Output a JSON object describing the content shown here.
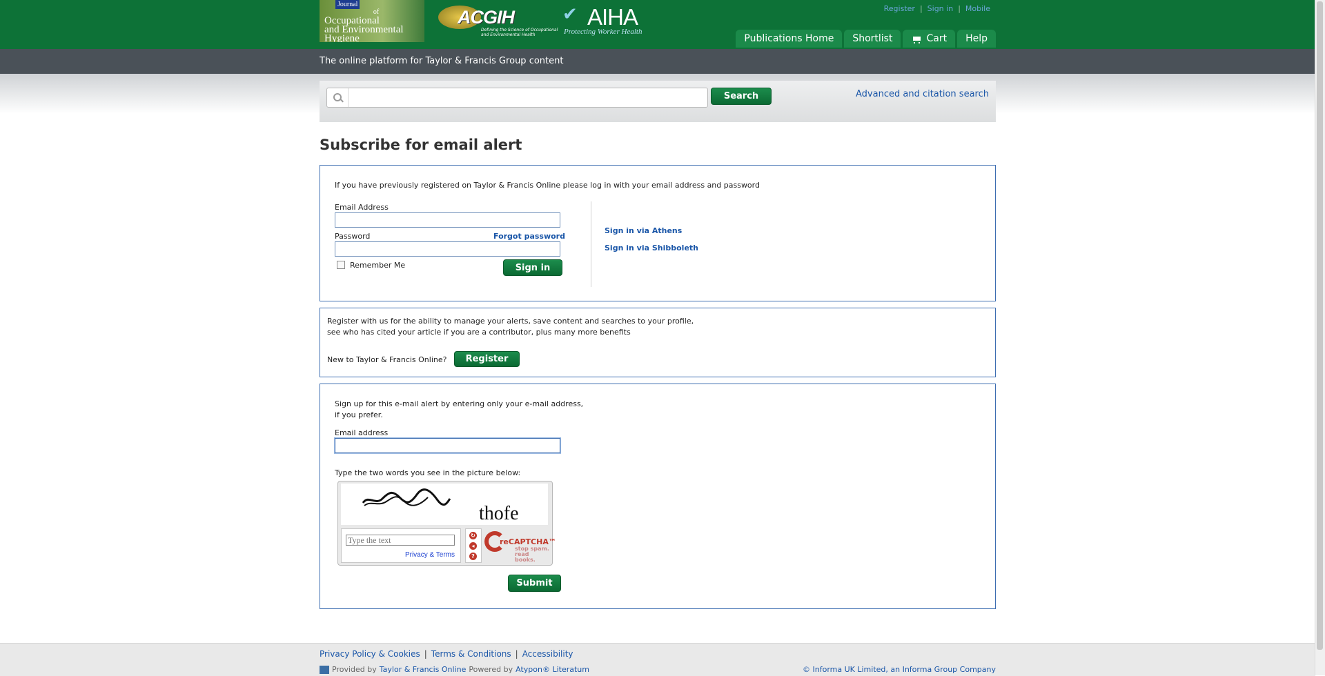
{
  "header": {
    "journal_logo": {
      "badge": "Journal",
      "line1": "of",
      "line2": "Occupational",
      "line3": "and Environmental",
      "line4": "Hygiene"
    },
    "acgih_logo": {
      "name": "ACGIH",
      "tagline": "Defining the Science of Occupational and Environmental Health"
    },
    "aiha_logo": {
      "name": "AIHA",
      "tagline": "Protecting Worker Health"
    },
    "top_links": [
      "Register",
      "Sign in",
      "Mobile"
    ],
    "nav_tabs": [
      "Publications Home",
      "Shortlist",
      "Cart",
      "Help"
    ],
    "platform_text": "The online platform for Taylor & Francis Group content"
  },
  "search": {
    "placeholder": "",
    "button_label": "Search",
    "advanced_link": "Advanced and citation search"
  },
  "page_title": "Subscribe for email alert",
  "login_panel": {
    "intro": "If you have previously registered on Taylor & Francis Online please log in with your email address and password",
    "email_label": "Email Address",
    "password_label": "Password",
    "forgot_link": "Forgot password",
    "remember_label": "Remember Me",
    "sign_in_button": "Sign in",
    "athens_link": "Sign in via Athens",
    "shibboleth_link": "Sign in via Shibboleth"
  },
  "register_panel": {
    "line1": "Register with us for the ability to manage your alerts, save content and searches to your profile,",
    "line2": "see who has cited your article if you are a contributor, plus many more benefits",
    "new_label": "New to Taylor & Francis Online?",
    "register_button": "Register"
  },
  "alert_panel": {
    "line1": "Sign up for this e-mail alert by entering only your e-mail address,",
    "line2": "if you prefer.",
    "email_label": "Email address",
    "captcha_instruction": "Type the two words you see in the picture below:",
    "captcha_word": "thofe",
    "captcha_placeholder": "Type the text",
    "privacy_terms": "Privacy & Terms",
    "recaptcha_brand": "reCAPTCHA™",
    "recaptcha_slogan1": "stop spam.",
    "recaptcha_slogan2": "read books.",
    "submit_button": "Submit"
  },
  "footer": {
    "links": [
      "Privacy Policy & Cookies",
      "Terms & Conditions",
      "Accessibility"
    ],
    "provided_by": "Provided by",
    "provider": "Taylor & Francis Online",
    "powered_by": "Powered by",
    "platform": "Atypon® Literatum",
    "copyright": "© Informa UK Limited, an Informa Group Company"
  },
  "colors": {
    "brand_green": "#0d7237",
    "link_blue": "#1a56a8",
    "panel_border": "#3c6db1"
  }
}
